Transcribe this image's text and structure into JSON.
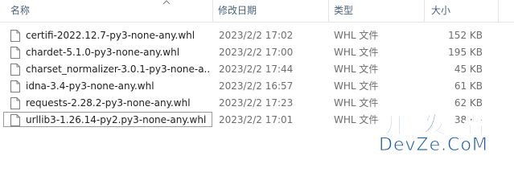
{
  "columns": {
    "name": "名称",
    "date": "修改日期",
    "type": "类型",
    "size": "大小"
  },
  "sort_icon": "chevron-up-icon",
  "files": [
    {
      "name": "certifi-2022.12.7-py3-none-any.whl",
      "date": "2023/2/2 17:02",
      "type": "WHL 文件",
      "size": "152 KB"
    },
    {
      "name": "chardet-5.1.0-py3-none-any.whl",
      "date": "2023/2/2 17:00",
      "type": "WHL 文件",
      "size": "195 KB"
    },
    {
      "name": "charset_normalizer-3.0.1-py3-none-a...",
      "date": "2023/2/2 17:44",
      "type": "WHL 文件",
      "size": "45 KB"
    },
    {
      "name": "idna-3.4-py3-none-any.whl",
      "date": "2023/2/2 16:57",
      "type": "WHL 文件",
      "size": "61 KB"
    },
    {
      "name": "requests-2.28.2-py3-none-any.whl",
      "date": "2023/2/2 17:23",
      "type": "WHL 文件",
      "size": "62 KB"
    },
    {
      "name": "urllib3-1.26.14-py2.py3-none-any.whl",
      "date": "2023/2/2 17:01",
      "type": "WHL 文件",
      "size": "38 KB"
    }
  ],
  "selected_index": 5,
  "watermark": {
    "line1": "开 发 者",
    "line2": "DevZe.CoM"
  },
  "colors": {
    "header_text": "#4c607a",
    "muted_text": "#6d6d6d",
    "watermark": "#1a5aa8"
  }
}
